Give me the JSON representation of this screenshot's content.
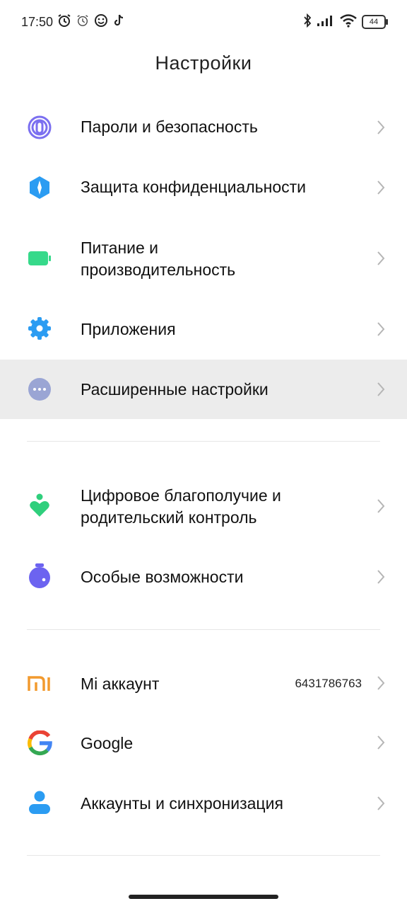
{
  "status_bar": {
    "time": "17:50",
    "battery": "44"
  },
  "header": {
    "title": "Настройки"
  },
  "groups": [
    {
      "items": [
        {
          "label": "Пароли и безопасность",
          "icon": "fingerprint-icon",
          "color": "#7b6ff0"
        },
        {
          "label": "Защита конфиденциальности",
          "icon": "privacy-shield-icon",
          "color": "#2b9cf2"
        },
        {
          "label": "Питание и производительность",
          "icon": "battery-icon",
          "color": "#36d98a"
        },
        {
          "label": "Приложения",
          "icon": "apps-gear-icon",
          "color": "#2b9cf2"
        },
        {
          "label": "Расширенные настройки",
          "icon": "more-dots-icon",
          "color": "#9aa5d4",
          "highlighted": true
        }
      ]
    },
    {
      "items": [
        {
          "label": "Цифровое благополучие и родительский контроль",
          "icon": "wellbeing-icon",
          "color": "#2fcf7c"
        },
        {
          "label": "Особые возможности",
          "icon": "accessibility-icon",
          "color": "#6c63f0"
        }
      ]
    },
    {
      "items": [
        {
          "label": "Mi аккаунт",
          "icon": "mi-logo-icon",
          "color": "#f29a2e",
          "value": "6431786763"
        },
        {
          "label": "Google",
          "icon": "google-icon",
          "color": "#4285f4"
        },
        {
          "label": "Аккаунты и синхронизация",
          "icon": "user-account-icon",
          "color": "#2b9cf2"
        }
      ]
    }
  ]
}
